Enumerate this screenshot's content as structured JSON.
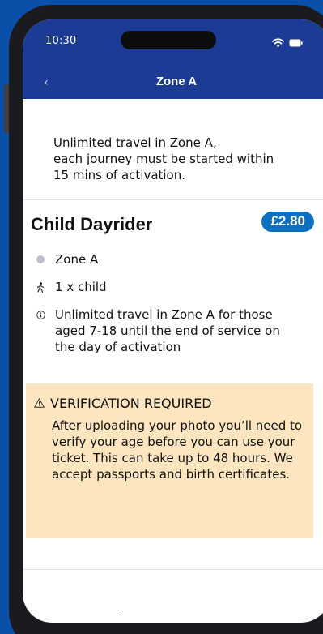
{
  "status_bar": {
    "time": "10:30",
    "icons": [
      "wifi-icon",
      "battery-icon"
    ]
  },
  "nav": {
    "back_label": "‹",
    "title": "Zone A"
  },
  "intro": {
    "text": "Unlimited travel in Zone A,\neach journey must be started within\n15 mins of activation."
  },
  "ticket": {
    "name": "Child Dayrider",
    "price": "£2.80",
    "details": [
      {
        "icon": "zone-dot-icon",
        "text": "Zone A"
      },
      {
        "icon": "person-walking-icon",
        "text": "1 x child"
      },
      {
        "icon": "info-icon",
        "text": "Unlimited travel in Zone A for those aged 7-18 until the end of service on the day of activation"
      }
    ]
  },
  "verification": {
    "icon": "warning-icon",
    "title": "VERIFICATION REQUIRED",
    "body": "After uploading your photo you’ll need to verify your age before you can use your ticket. This can take up to 48 hours. We accept passports and birth certificates."
  },
  "colors": {
    "background": "#0a4fa8",
    "header": "#1c3b95",
    "price_badge": "#0d6fc1",
    "warning_bg": "#fde5bf",
    "zone_dot": "#bdbdd2"
  }
}
